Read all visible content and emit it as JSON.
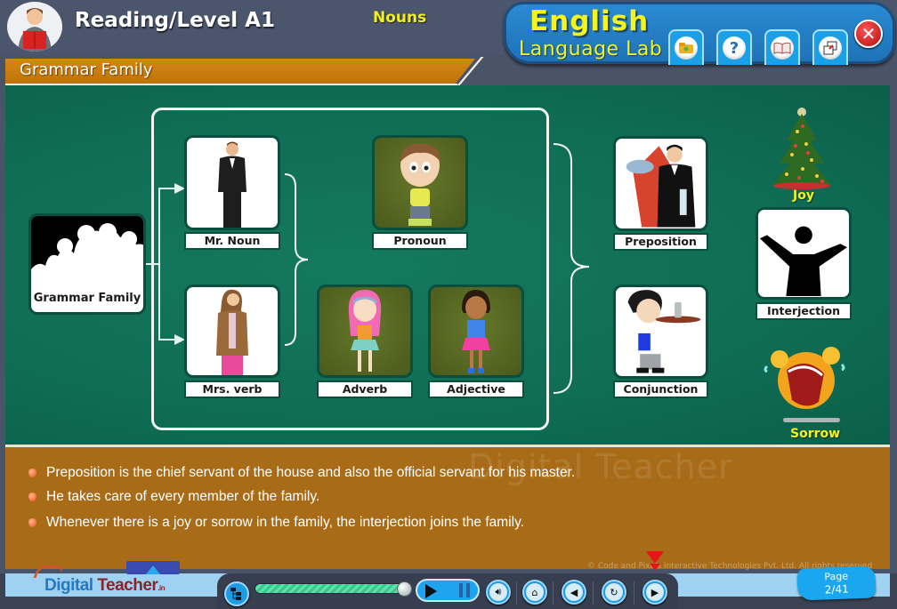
{
  "header": {
    "title": "Reading/Level A1",
    "topic": "Nouns",
    "brand_line1": "English",
    "brand_line2": "Language Lab",
    "toolbar": [
      {
        "name": "gallery",
        "icon": "folder-icon"
      },
      {
        "name": "help",
        "icon": "help-icon",
        "glyph": "?"
      },
      {
        "name": "book",
        "icon": "book-icon"
      },
      {
        "name": "window",
        "icon": "resize-window-icon"
      }
    ],
    "close_glyph": "✕"
  },
  "section": {
    "title": "Grammar Family"
  },
  "diagram": {
    "root": {
      "label": "Grammar Family"
    },
    "cards": {
      "noun": {
        "label": "Mr. Noun"
      },
      "verb": {
        "label": "Mrs. verb"
      },
      "pronoun": {
        "label": "Pronoun"
      },
      "adverb": {
        "label": "Adverb"
      },
      "adjective": {
        "label": "Adjective"
      },
      "preposition": {
        "label": "Preposition"
      },
      "conjunction": {
        "label": "Conjunction"
      },
      "interjection": {
        "label": "Interjection"
      }
    },
    "joy_label": "Joy",
    "sorrow_label": "Sorrow"
  },
  "notes": {
    "watermark": "Digital Teacher",
    "items": [
      "Preposition is the chief servant of the house and also the official servant for his master.",
      "He takes care of every member of the family.",
      "Whenever there is a joy or sorrow in the family, the interjection joins the family."
    ],
    "copyright": "© Code and Pixels Interactive Technologies Pvt. Ltd. All rights reserved"
  },
  "footer": {
    "logo_main": "Digital",
    "logo_teacher": "Teacher",
    "logo_suffix": ".in",
    "progress_percent": 97,
    "page_label": "Page",
    "page_value": "2/41"
  }
}
